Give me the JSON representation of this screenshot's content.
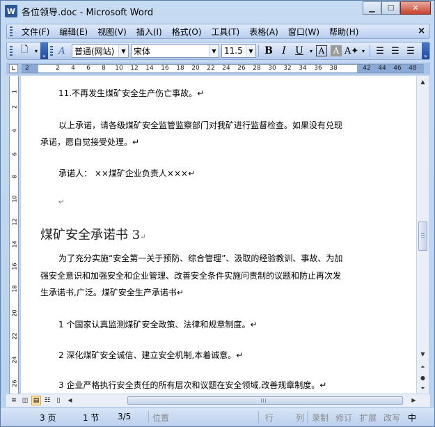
{
  "window": {
    "title": "各位领导.doc - Microsoft Word",
    "icon": "W"
  },
  "menu": [
    "文件(F)",
    "编辑(E)",
    "视图(V)",
    "插入(I)",
    "格式(O)",
    "工具(T)",
    "表格(A)",
    "窗口(W)",
    "帮助(H)"
  ],
  "menu_close": "×",
  "toolbar": {
    "style_value": "普通(网站)",
    "font_value": "宋体",
    "size_value": "11.5",
    "bold": "B",
    "italic": "I",
    "underline": "U"
  },
  "ruler": {
    "ticks": [
      "2",
      "2",
      "4",
      "6",
      "8",
      "10",
      "12",
      "14",
      "16",
      "18",
      "20",
      "22",
      "24",
      "26",
      "28",
      "30",
      "32",
      "34",
      "36",
      "38",
      "42",
      "44",
      "46",
      "48"
    ]
  },
  "vruler": {
    "ticks": [
      "1",
      "2",
      "4",
      "6",
      "8",
      "10",
      "12",
      "14",
      "16",
      "18",
      "20",
      "22",
      "24",
      "26"
    ]
  },
  "doc": {
    "item11": "11.不再发生煤矿安全生产伤亡事故。↵",
    "para1_line1": "以上承诺，请各级煤矿安全监管监察部门对我矿进行监督检查。如果没有兑现",
    "para1_line2": "承诺，愿自觉接受处理。↵",
    "signer": "承诺人：  ××煤矿企业负责人×××↵",
    "blank": "↵",
    "heading": "煤矿安全承诺书 3",
    "heading_mark": "↵",
    "para2_line1": "为了充分实施“安全第一关于预防、综合管理”、汲取的经验教训、事故、为加",
    "para2_line2": "强安全意识和加强安全和企业管理、改善安全条件实施问责制的议题和防止再次发",
    "para2_line3": "生承诺书,广泛。煤矿安全生产承诺书↵",
    "item1": "1 个国家认真监测煤矿安全政策、法律和规章制度。↵",
    "item2": "2 深化煤矿安全诚信、建立安全机制,本着诚意。↵",
    "item3": "3 企业严格执行安全责任的所有层次和议题在安全领域,改善规章制度。↵"
  },
  "status": {
    "page": "3 页",
    "section": "1 节",
    "position": "3/5",
    "at": "位置",
    "line": "行",
    "col": "列",
    "rec": "录制",
    "trk": "修订",
    "ext": "扩展",
    "ovr": "改写",
    "lang": "中"
  }
}
